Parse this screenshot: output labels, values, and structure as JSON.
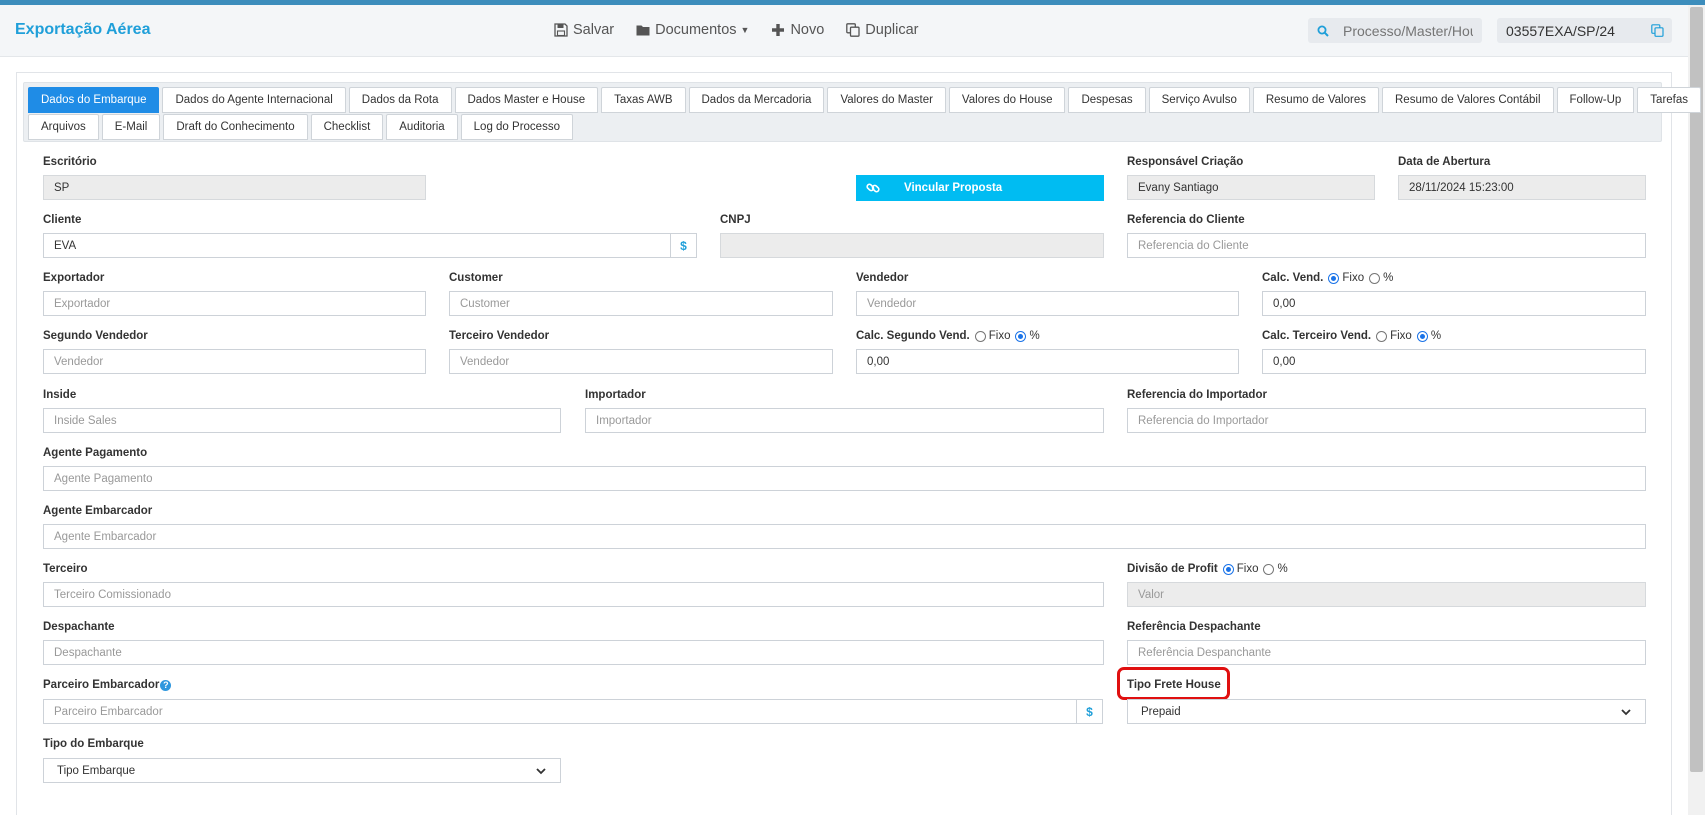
{
  "app": {
    "title": "Exportação Aérea"
  },
  "toolbar": {
    "save": "Salvar",
    "documents": "Documentos",
    "new": "Novo",
    "duplicate": "Duplicar"
  },
  "search": {
    "placeholder": "Processo/Master/House",
    "process_number": "03557EXA/SP/24"
  },
  "tabs_row1": [
    "Dados do Embarque",
    "Dados do Agente Internacional",
    "Dados da Rota",
    "Dados Master e House",
    "Taxas AWB",
    "Dados da Mercadoria",
    "Valores do Master",
    "Valores do House",
    "Despesas",
    "Serviço Avulso",
    "Resumo de Valores",
    "Resumo de Valores Contábil",
    "Follow-Up",
    "Tarefas"
  ],
  "tabs_row2": [
    "Arquivos",
    "E-Mail",
    "Draft do Conhecimento",
    "Checklist",
    "Auditoria",
    "Log do Processo"
  ],
  "active_tab": "Dados do Embarque",
  "form": {
    "escritorio": {
      "label": "Escritório",
      "value": "SP"
    },
    "vincular_button": "Vincular Proposta",
    "responsavel": {
      "label": "Responsável Criação",
      "value": "Evany Santiago"
    },
    "data_abertura": {
      "label": "Data de Abertura",
      "value": "28/11/2024 15:23:00"
    },
    "cliente": {
      "label": "Cliente",
      "value": "EVA",
      "addon": "$"
    },
    "cnpj": {
      "label": "CNPJ",
      "value": ""
    },
    "ref_cliente": {
      "label": "Referencia do Cliente",
      "placeholder": "Referencia do Cliente"
    },
    "exportador": {
      "label": "Exportador",
      "placeholder": "Exportador"
    },
    "customer": {
      "label": "Customer",
      "placeholder": "Customer"
    },
    "vendedor": {
      "label": "Vendedor",
      "placeholder": "Vendedor"
    },
    "calc_vend": {
      "label": "Calc. Vend.",
      "opt_fixo": "Fixo",
      "opt_pct": "%",
      "selected": "Fixo",
      "value": "0,00"
    },
    "segundo_vendedor": {
      "label": "Segundo Vendedor",
      "placeholder": "Vendedor"
    },
    "terceiro_vendedor": {
      "label": "Terceiro Vendedor",
      "placeholder": "Vendedor"
    },
    "calc_segundo": {
      "label": "Calc. Segundo Vend.",
      "opt_fixo": "Fixo",
      "opt_pct": "%",
      "selected": "%",
      "value": "0,00"
    },
    "calc_terceiro": {
      "label": "Calc. Terceiro Vend.",
      "opt_fixo": "Fixo",
      "opt_pct": "%",
      "selected": "%",
      "value": "0,00"
    },
    "inside": {
      "label": "Inside",
      "placeholder": "Inside Sales"
    },
    "importador": {
      "label": "Importador",
      "placeholder": "Importador"
    },
    "ref_importador": {
      "label": "Referencia do Importador",
      "placeholder": "Referencia do Importador"
    },
    "agente_pagamento": {
      "label": "Agente Pagamento",
      "placeholder": "Agente Pagamento"
    },
    "agente_embarcador": {
      "label": "Agente Embarcador",
      "placeholder": "Agente Embarcador"
    },
    "terceiro": {
      "label": "Terceiro",
      "placeholder": "Terceiro Comissionado"
    },
    "divisao_profit": {
      "label": "Divisão de Profit",
      "opt_fixo": "Fixo",
      "opt_pct": "%",
      "selected": "Fixo",
      "placeholder": "Valor"
    },
    "despachante": {
      "label": "Despachante",
      "placeholder": "Despachante"
    },
    "ref_despachante": {
      "label": "Referência Despachante",
      "placeholder": "Referência Despanchante"
    },
    "parceiro_embarcador": {
      "label": "Parceiro Embarcador",
      "placeholder": "Parceiro Embarcador",
      "addon": "$"
    },
    "tipo_frete_house": {
      "label": "Tipo Frete House",
      "value": "Prepaid"
    },
    "tipo_embarque": {
      "label": "Tipo do Embarque",
      "value": "Tipo Embarque"
    }
  },
  "colors": {
    "brand": "#1f9fd9",
    "active_tab": "#1f8ce6",
    "link_button": "#00bcf2",
    "annotation": "#e01010"
  }
}
